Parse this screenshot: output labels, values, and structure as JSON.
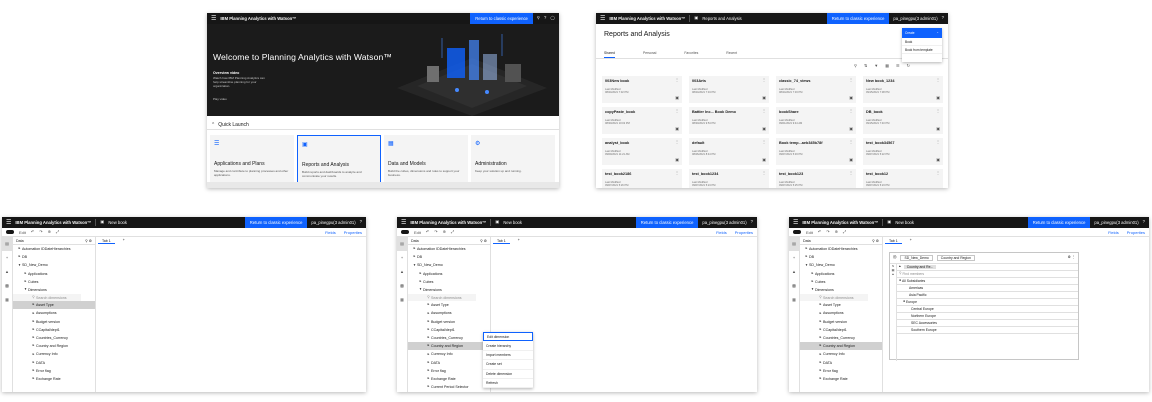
{
  "welcome": {
    "topbar_title": "IBM Planning Analytics with Watson™",
    "return_link": "Return to classic experience",
    "headline": "Welcome to Planning Analytics with Watson™",
    "overview_title": "Overview video",
    "overview_desc": "Watch how IBM Planning Analytics can help streamline planning for your organization.",
    "play_label": "Play video",
    "quick_launch": "Quick Launch",
    "cards": [
      {
        "title": "Applications and Plans",
        "desc": "Manage and contribute to planning processes and other applications."
      },
      {
        "title": "Reports and Analysis",
        "desc": "Build reports and dashboards to analyze and communicate your results."
      },
      {
        "title": "Data and Models",
        "desc": "Build the cubes, dimensions and rules to support your business."
      },
      {
        "title": "Administration",
        "desc": "Keep your solution up and running."
      }
    ]
  },
  "reports": {
    "topbar_title": "IBM Planning Analytics with Watson™",
    "crumb": "Reports and Analysis",
    "return_link": "Return to classic experience",
    "user": "pa_pinegpu(3 admin01)",
    "title": "Reports and Analysis",
    "tabs": [
      "Shared",
      "Personal",
      "Favorites",
      "Recent"
    ],
    "dropdown": {
      "header": "Create",
      "items": [
        "Book",
        "Book from template"
      ]
    },
    "cards": [
      {
        "name": "003New book",
        "mod": "Last Modified",
        "date": "08/24/2021 7:32 PM"
      },
      {
        "name": "003Arts",
        "mod": "Last Modified",
        "date": "08/24/2021 7:34 PM"
      },
      {
        "name": "classic_74_views",
        "mod": "Last Modified",
        "date": "08/24/2021 7:33 PM"
      },
      {
        "name": "New book_1234",
        "mod": "Last Modified",
        "date": "09/15/2021 7:38 PM"
      },
      {
        "name": "copyPaste_book",
        "mod": "Last Modified",
        "date": "08/30/2021 10:02 PM"
      },
      {
        "name": "Battler Inc... Book Demo",
        "mod": "Last Modified",
        "date": "08/30/2021 9:54 PM"
      },
      {
        "name": "bookShare",
        "mod": "Last Modified",
        "date": "09/01/2021 9:44 AM"
      },
      {
        "name": "DB_book",
        "mod": "Last Modified",
        "date": "09/15/2021 7:40 PM"
      },
      {
        "name": "analyst_book",
        "mod": "Last Modified",
        "date": "09/09/2021 11:21 AM"
      },
      {
        "name": "default",
        "mod": "Last Modified",
        "date": "08/26/2021 8:44 PM"
      },
      {
        "name": "Book temp...aeb345b78f",
        "mod": "Last Modified",
        "date": "09/07/2021 5:33 PM"
      },
      {
        "name": "test_book34567",
        "mod": "Last Modified",
        "date": "09/07/2021 5:22 PM"
      },
      {
        "name": "test_book2186",
        "mod": "Last Modified",
        "date": "09/07/2021 5:26 PM"
      },
      {
        "name": "test_book1234",
        "mod": "Last Modified",
        "date": "09/07/2021 5:24 PM"
      },
      {
        "name": "test_book123",
        "mod": "Last Modified",
        "date": "09/07/2021 5:25 PM"
      },
      {
        "name": "test_book12",
        "mod": "Last Modified",
        "date": "09/07/2021 5:23 PM"
      }
    ]
  },
  "book": {
    "topbar_title": "IBM Planning Analytics with Watson™",
    "book_name": "New book",
    "return_link": "Return to classic experience",
    "user": "pa_pinegpu(3 admin01)",
    "edit_label": "Edit",
    "fields_label": "Fields",
    "properties_label": "Properties",
    "tree_header": "Data",
    "tab_label": "Tab 1",
    "tree_nodes": [
      "Automation IDDateHierarchies",
      "DB",
      "SD_New_Demo",
      "Applications",
      "Cubes",
      "Dimensions",
      "Search dimensions",
      "Asset Type",
      "Assumptions",
      "Budget version",
      "CCapital/dept1",
      "Countries_Currency",
      "Country and Region",
      "Currency Info",
      "DATA",
      "Error flag",
      "Exchange Rate"
    ],
    "tree_nodes_b": [
      "Automation IDDateHierarchies",
      "DB",
      "SD_New_Demo",
      "Applications",
      "Cubes",
      "Dimensions",
      "Search dimensions",
      "Asset Type",
      "Assumptions",
      "Budget version",
      "CCapital/dept1",
      "Countries_Currency",
      "Country and Region",
      "Currency Info",
      "DATA",
      "Error flag",
      "Exchange Rate",
      "Current Period Selector"
    ],
    "context_menu": [
      "Edit dimension",
      "Create hierarchy",
      "Import members",
      "Create set",
      "Delete dimension",
      "Refresh"
    ],
    "xview": {
      "cube_title": "SD_New_Demo",
      "dim1": "Country and Re...",
      "dim2": "Country and Region",
      "search_placeholder": "Find members",
      "rows": [
        "All Subsidiaries",
        "Americas",
        "Asia Pacific",
        "Europe",
        "Central Europe",
        "Northern Europe",
        "SEC Accessories",
        "Southern Europe"
      ]
    }
  }
}
